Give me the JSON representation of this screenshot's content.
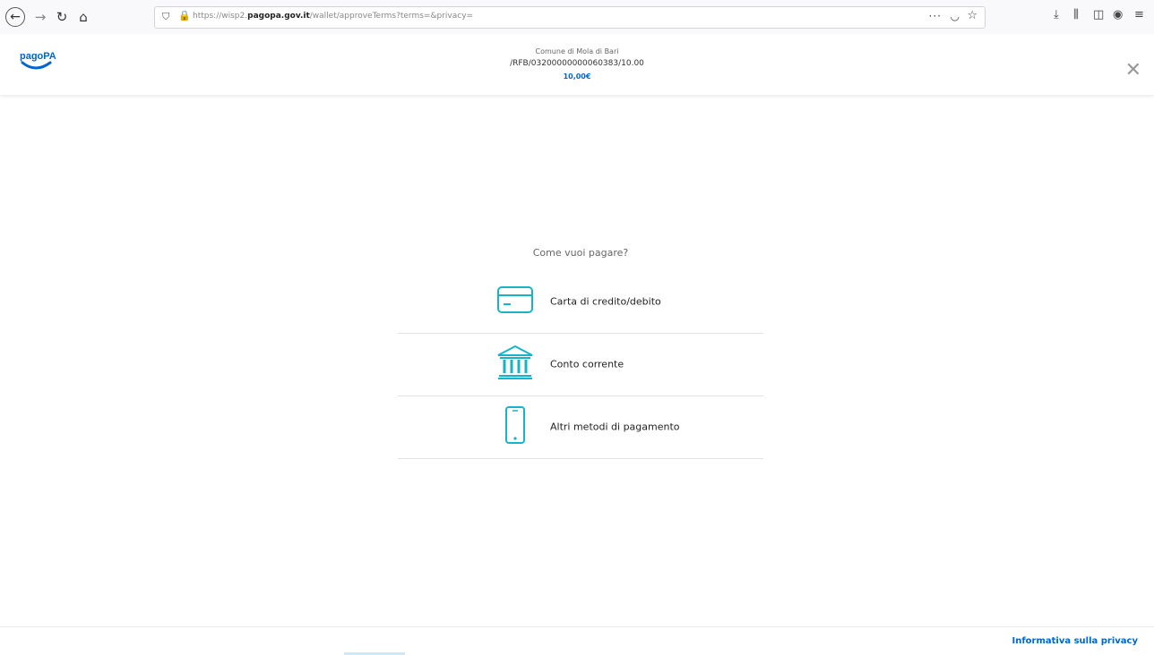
{
  "browser": {
    "url_prefix": "https://wisp2.",
    "url_domain": "pagopa.gov.it",
    "url_path": "/wallet/approveTerms?terms=&privacy=",
    "icons": [
      "back-icon",
      "forward-icon",
      "reload-icon",
      "home-icon",
      "shield-icon",
      "lock-icon",
      "more-icon",
      "pocket-icon",
      "star-icon",
      "download-icon",
      "library-icon",
      "sidebar-icon",
      "account-icon",
      "menu-icon"
    ]
  },
  "header": {
    "logo_text": "pagoPA",
    "entity": "Comune di Mola di Bari",
    "reference": "/RFB/03200000000060383/10.00",
    "amount": "10,00€"
  },
  "main": {
    "question": "Come vuoi pagare?",
    "methods": [
      {
        "label": "Carta di credito/debito",
        "icon": "credit-card-icon"
      },
      {
        "label": "Conto corrente",
        "icon": "bank-icon"
      },
      {
        "label": "Altri metodi di pagamento",
        "icon": "smartphone-icon"
      }
    ]
  },
  "footer": {
    "privacy_link": "Informativa sulla privacy"
  },
  "colors": {
    "accent": "#17b4c7",
    "link": "#0066cc"
  }
}
